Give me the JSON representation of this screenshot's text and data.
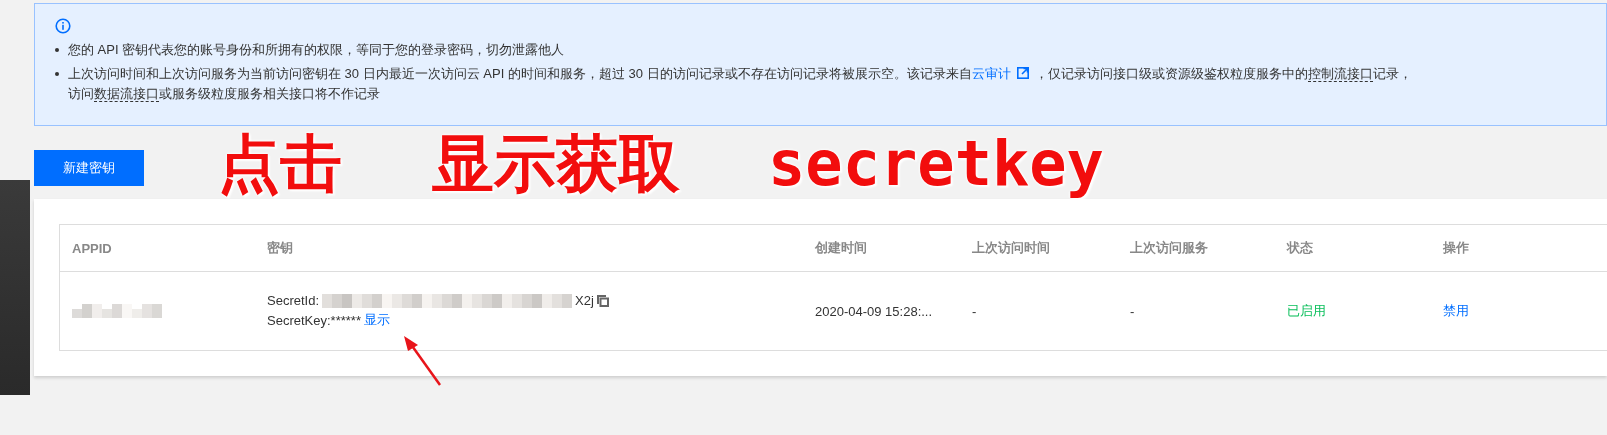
{
  "notice": {
    "bullets": [
      {
        "lines": [
          [
            {
              "kind": "text",
              "text": "您的 API 密钥代表您的账号身份和所拥有的权限，等同于您的登录密码，切勿泄露他人"
            }
          ]
        ]
      },
      {
        "lines": [
          [
            {
              "kind": "text",
              "text": "上次访问时间和上次访问服务为当前访问密钥在 30 日内最近一次访问云 API 的时间和服务，超过 30 日的访问记录或不存在访问记录将被展示空。该记录来自"
            },
            {
              "kind": "link",
              "text": "云审计"
            },
            {
              "kind": "text",
              "text": "，仅记录访问接口级或资源级鉴权粒度服务中的"
            },
            {
              "kind": "term",
              "text": "控制流接口"
            },
            {
              "kind": "text",
              "text": "记录，"
            }
          ],
          [
            {
              "kind": "text",
              "text": "访问"
            },
            {
              "kind": "term",
              "text": "数据流接口"
            },
            {
              "kind": "text",
              "text": "或服务级粒度服务相关接口将不作记录"
            }
          ]
        ]
      }
    ]
  },
  "create_button": "新建密钥",
  "annotation": [
    "点击",
    "显示获取",
    "secretkey"
  ],
  "table": {
    "columns": [
      "APPID",
      "密钥",
      "创建时间",
      "上次访问时间",
      "上次访问服务",
      "状态",
      "操作"
    ],
    "rows": [
      {
        "secret_id_label": "SecretId:",
        "secret_id_end": "X2j",
        "secret_key_label": "SecretKey:******",
        "show_link": "显示",
        "created": "2020-04-09 15:28:...",
        "last_access_time": "-",
        "last_access_service": "-",
        "status": "已启用",
        "color": "#0abf5b",
        "action": "禁用"
      }
    ]
  }
}
